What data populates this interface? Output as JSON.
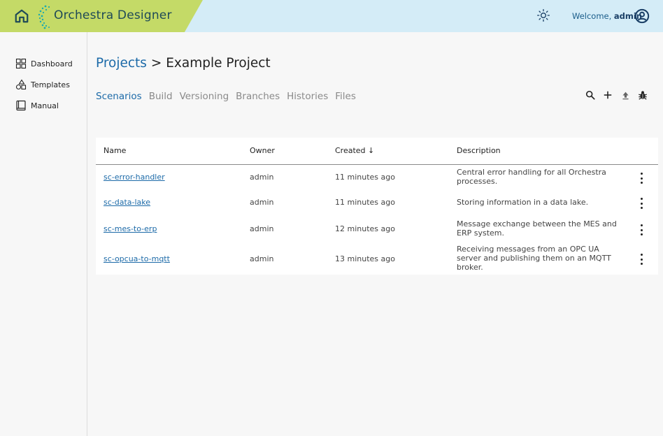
{
  "header": {
    "brand": "Orchestra Designer",
    "welcome_prefix": "Welcome,",
    "username": "admin",
    "colors": {
      "green": "#c4da67",
      "blue": "#d4ecf7",
      "brand_text": "#1f4a57"
    }
  },
  "sidebar": {
    "items": [
      {
        "label": "Dashboard",
        "icon": "dashboard-grid-icon"
      },
      {
        "label": "Templates",
        "icon": "templates-shapes-icon"
      },
      {
        "label": "Manual",
        "icon": "book-icon"
      }
    ]
  },
  "breadcrumb": {
    "parent": "Projects",
    "separator": ">",
    "current": "Example Project"
  },
  "tabs": [
    {
      "label": "Scenarios",
      "active": true
    },
    {
      "label": "Build",
      "active": false
    },
    {
      "label": "Versioning",
      "active": false
    },
    {
      "label": "Branches",
      "active": false
    },
    {
      "label": "Histories",
      "active": false
    },
    {
      "label": "Files",
      "active": false
    }
  ],
  "toolbar": {
    "icons": [
      "search-icon",
      "add-icon",
      "upload-icon",
      "debug-bug-icon"
    ]
  },
  "table": {
    "columns": [
      "Name",
      "Owner",
      "Created ↓",
      "Description"
    ],
    "rows": [
      {
        "name": "sc-error-handler",
        "owner": "admin",
        "created": "11 minutes ago",
        "description": "Central error handling for all Orchestra processes."
      },
      {
        "name": "sc-data-lake",
        "owner": "admin",
        "created": "11 minutes ago",
        "description": "Storing information in a data lake."
      },
      {
        "name": "sc-mes-to-erp",
        "owner": "admin",
        "created": "12 minutes ago",
        "description": "Message exchange between the MES and ERP system."
      },
      {
        "name": "sc-opcua-to-mqtt",
        "owner": "admin",
        "created": "13 minutes ago",
        "description": "Receiving messages from an OPC UA server and publishing them on an MQTT broker."
      }
    ]
  },
  "accent_color": "#1c6aa8"
}
